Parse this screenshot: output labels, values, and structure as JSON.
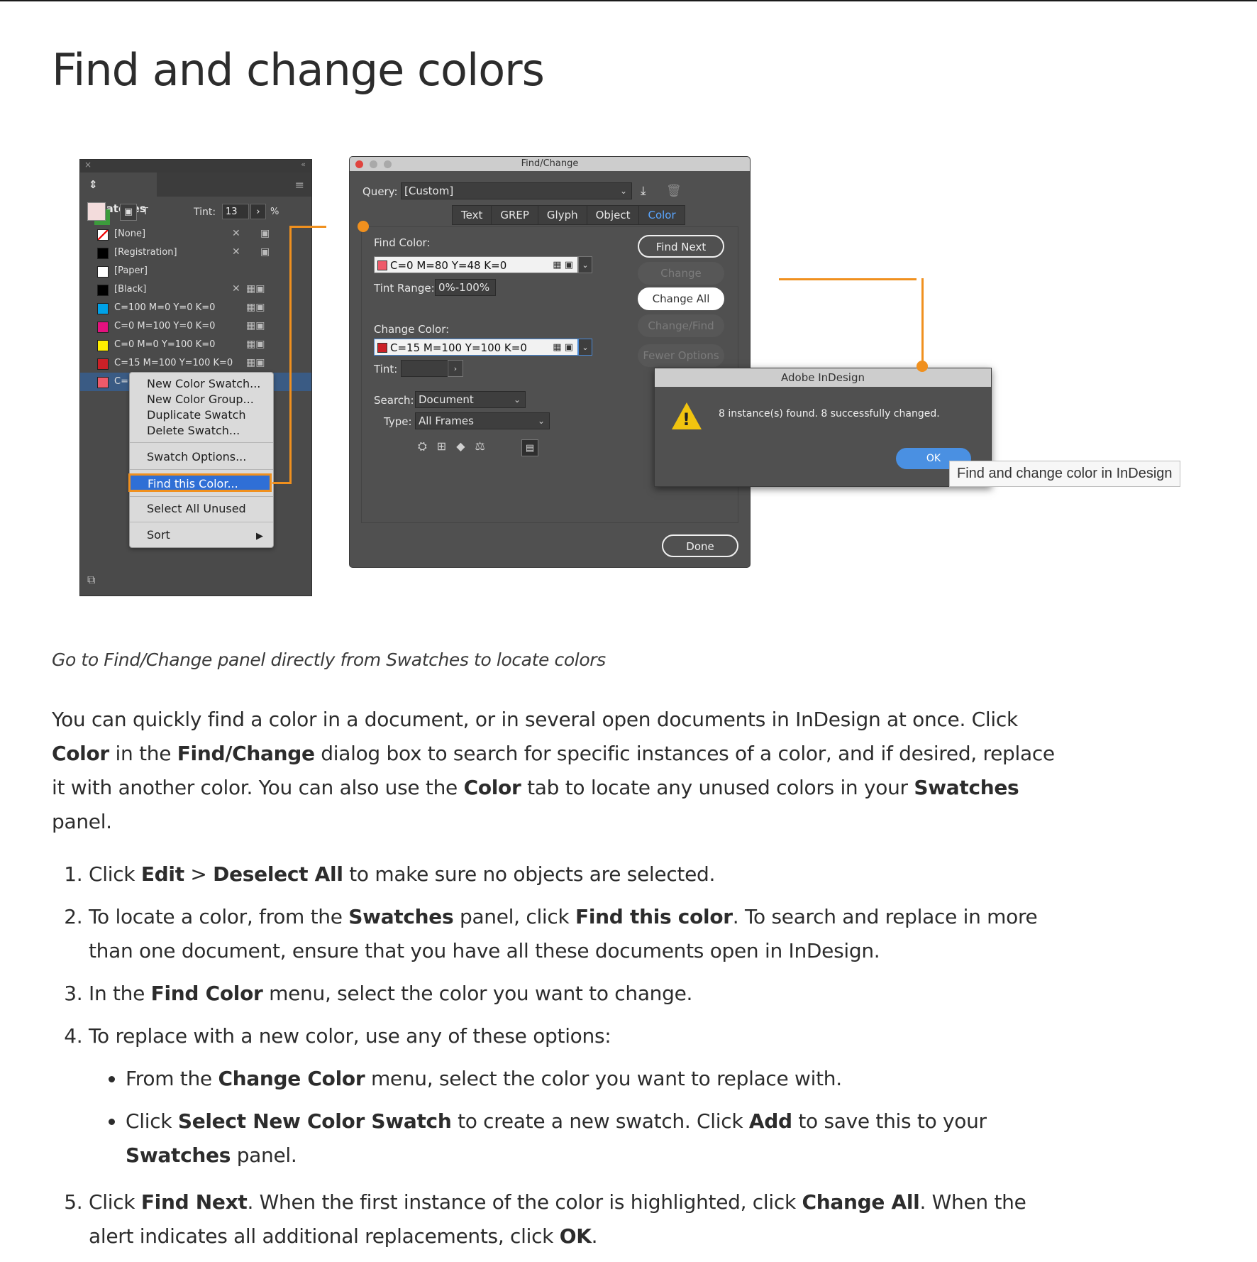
{
  "page": {
    "title": "Find and change colors",
    "caption": "Go to Find/Change panel directly from Swatches to locate colors"
  },
  "swatches_panel": {
    "tab_label": "Swatches",
    "tint_label": "Tint:",
    "tint_value": "13",
    "tint_unit": "%",
    "swatches": [
      {
        "name": "[None]",
        "color": "#ffffff"
      },
      {
        "name": "[Registration]",
        "color": "#000000"
      },
      {
        "name": "[Paper]",
        "color": "#ffffff"
      },
      {
        "name": "[Black]",
        "color": "#000000"
      },
      {
        "name": "C=100 M=0 Y=0 K=0",
        "color": "#00a2e8"
      },
      {
        "name": "C=0 M=100 Y=0 K=0",
        "color": "#e4117f"
      },
      {
        "name": "C=0 M=0 Y=100 K=0",
        "color": "#ffee00"
      },
      {
        "name": "C=15 M=100 Y=100 K=0",
        "color": "#cc2027"
      },
      {
        "name": "C=0 M=80 Y=48 K=0",
        "color": "#ee5a6a"
      }
    ]
  },
  "context_menu": {
    "items_group1": [
      "New Color Swatch...",
      "New Color Group...",
      "Duplicate Swatch",
      "Delete Swatch..."
    ],
    "swatch_options": "Swatch Options...",
    "find_this_color": "Find this Color...",
    "select_all_unused": "Select All Unused",
    "sort": "Sort"
  },
  "find_change": {
    "title": "Find/Change",
    "query_label": "Query:",
    "query_value": "[Custom]",
    "tabs": [
      "Text",
      "GREP",
      "Glyph",
      "Object",
      "Color"
    ],
    "active_tab": "Color",
    "find_color_label": "Find Color:",
    "find_color_value": "C=0 M=80 Y=48 K=0",
    "tint_range_label": "Tint Range:",
    "tint_range_value": "0%-100%",
    "change_color_label": "Change Color:",
    "change_color_value": "C=15 M=100 Y=100 K=0",
    "tint_label": "Tint:",
    "search_label": "Search:",
    "search_value": "Document",
    "type_label": "Type:",
    "type_value": "All Frames",
    "buttons": {
      "find_next": "Find Next",
      "change": "Change",
      "change_all": "Change All",
      "change_find": "Change/Find",
      "fewer_options": "Fewer Options",
      "done": "Done"
    }
  },
  "alert": {
    "title": "Adobe InDesign",
    "message": "8 instance(s) found. 8 successfully changed.",
    "ok": "OK",
    "tooltip": "Find and change color in InDesign"
  },
  "colors": {
    "accent": "#f0901e",
    "active_tab": "#5aa6ff",
    "selection": "#2f6fd6"
  },
  "content": {
    "intro": [
      {
        "t": "You can quickly find a color in a document, or in several open documents in InDesign at once. Click "
      },
      {
        "b": "Color"
      },
      {
        "t": " in the "
      },
      {
        "b": "Find/Change"
      },
      {
        "t": " dialog box to search for specific instances of a color, and if desired, replace it with another color. You can also use the "
      },
      {
        "b": "Color"
      },
      {
        "t": " tab to locate any unused colors in your "
      },
      {
        "b": "Swatches"
      },
      {
        "t": " panel."
      }
    ],
    "step1": [
      {
        "t": "Click "
      },
      {
        "b": "Edit"
      },
      {
        "t": " > "
      },
      {
        "b": "Deselect All"
      },
      {
        "t": " to make sure no objects are selected."
      }
    ],
    "step2": [
      {
        "t": "To locate a color, from the "
      },
      {
        "b": "Swatches"
      },
      {
        "t": " panel, click "
      },
      {
        "b": "Find this color"
      },
      {
        "t": ". To search and replace in more than one document, ensure that you have all these documents open in InDesign."
      }
    ],
    "step3": [
      {
        "t": "In the "
      },
      {
        "b": "Find Color"
      },
      {
        "t": " menu, select the color you want to change."
      }
    ],
    "step4": [
      {
        "t": "To replace with a new color, use any of these options:"
      }
    ],
    "step4_bullet1": [
      {
        "t": "From the "
      },
      {
        "b": "Change Color"
      },
      {
        "t": " menu, select the color you want to replace with."
      }
    ],
    "step4_bullet2": [
      {
        "t": "Click "
      },
      {
        "b": "Select New Color Swatch"
      },
      {
        "t": " to create a new swatch. Click "
      },
      {
        "b": "Add"
      },
      {
        "t": " to save this to your "
      },
      {
        "b": "Swatches"
      },
      {
        "t": " panel."
      }
    ],
    "step5": [
      {
        "t": "Click "
      },
      {
        "b": "Find Next"
      },
      {
        "t": ". When the first instance of the color is highlighted, click "
      },
      {
        "b": "Change All"
      },
      {
        "t": ". When the alert indicates all additional replacements, click "
      },
      {
        "b": "OK"
      },
      {
        "t": "."
      }
    ]
  }
}
